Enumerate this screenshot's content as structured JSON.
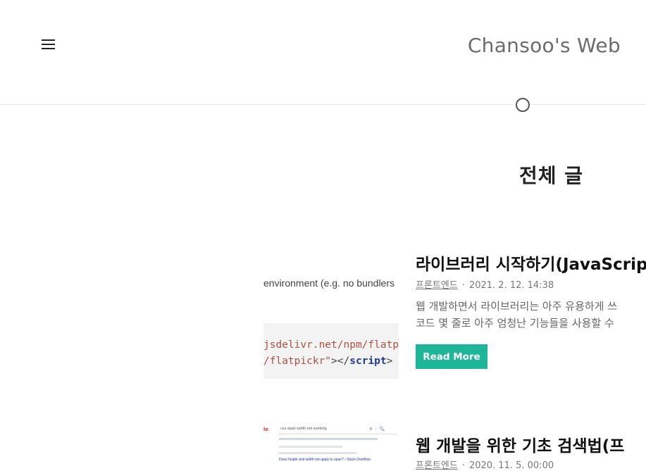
{
  "header": {
    "site_title": "Chansoo's Web",
    "menu_icon": "hamburger-menu-icon"
  },
  "page": {
    "heading": "전체 글"
  },
  "posts": [
    {
      "title": "라이브러리 시작하기(JavaScript)",
      "category": "프론트엔드",
      "separator": "·",
      "date": "2021. 2. 12. 14:38",
      "excerpt_lines": [
        "웹 개발하면서 라이브러리는 아주 유용하게 쓰",
        "코드 몇 줄로 아주 엄청난 기능들을 사용할 수"
      ],
      "read_more": "Read More",
      "thumbnail": {
        "top_text": "environment (e.g. no bundlers",
        "code_line1": "jsdelivr.net/npm/flatpi",
        "code_line2_str": "/flatpickr\"",
        "code_line2_punc": "></",
        "code_line2_tag": "script",
        "code_line2_end": ">"
      }
    },
    {
      "title": "웹 개발을 위한 기초 검색법(프",
      "category": "프론트엔드",
      "separator": "·",
      "date": "2020. 11. 5. 00:00",
      "thumbnail": {
        "search_text": "css span width not working",
        "result_link": "Does height and width not apply to span? - Stack Overflow",
        "logo_letter": "le"
      }
    }
  ],
  "colors": {
    "accent": "#1fb598",
    "title_gray": "#6b6b6b"
  }
}
